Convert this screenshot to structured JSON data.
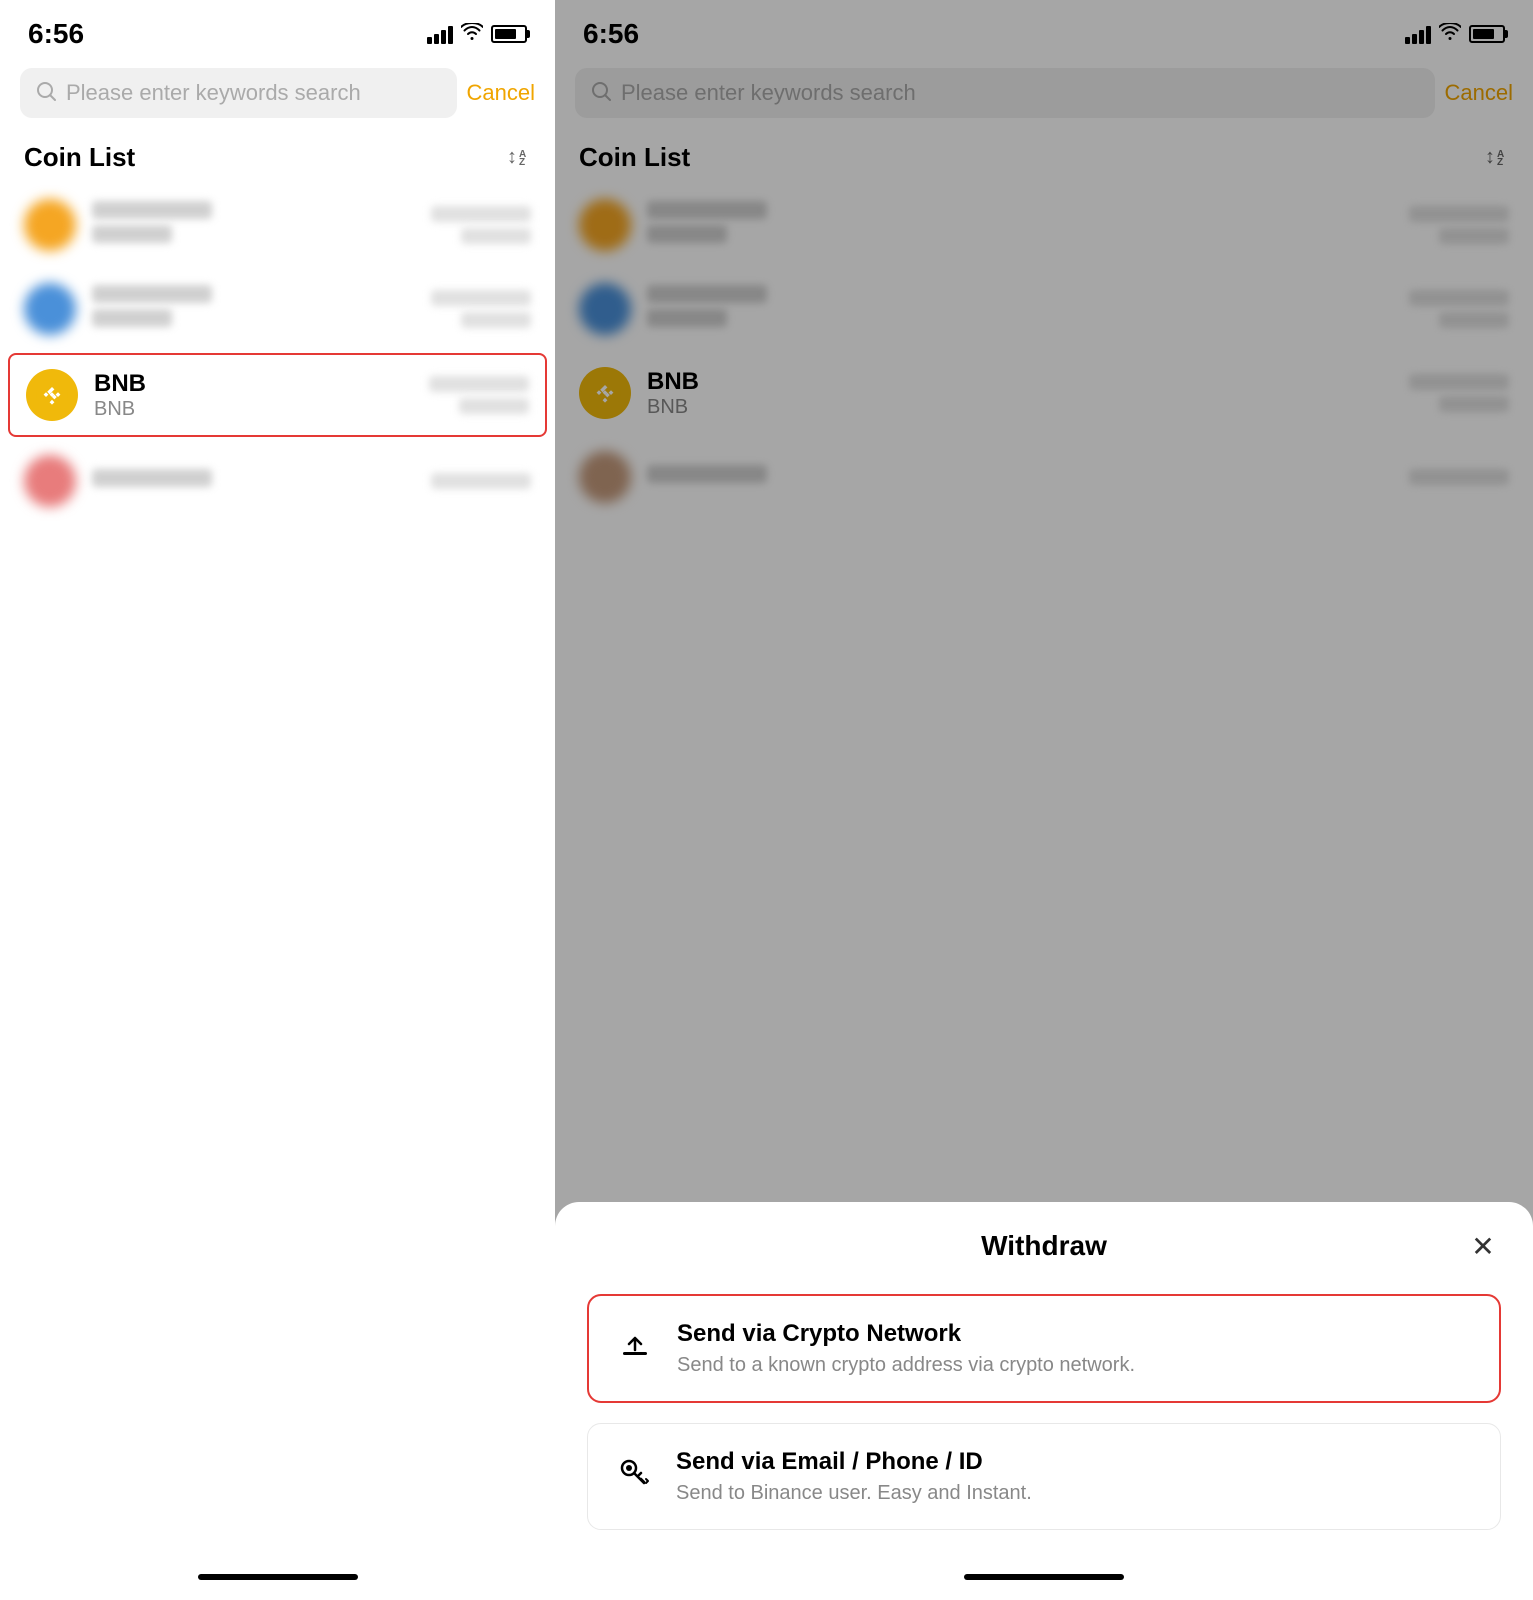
{
  "left_panel": {
    "status": {
      "time": "6:56"
    },
    "search": {
      "placeholder": "Please enter keywords search",
      "cancel_label": "Cancel"
    },
    "section": {
      "title": "Coin List"
    },
    "coins": [
      {
        "id": "coin-1",
        "name": "",
        "symbol": "",
        "icon_color": "orange",
        "highlighted": false,
        "blurred": true
      },
      {
        "id": "coin-2",
        "name": "",
        "symbol": "",
        "icon_color": "blue",
        "highlighted": false,
        "blurred": true
      },
      {
        "id": "bnb",
        "name": "BNB",
        "symbol": "BNB",
        "icon_color": "bnb",
        "highlighted": true,
        "blurred": false
      },
      {
        "id": "coin-4",
        "name": "",
        "symbol": "",
        "icon_color": "pink",
        "highlighted": false,
        "blurred": true
      }
    ]
  },
  "right_panel": {
    "status": {
      "time": "6:56"
    },
    "search": {
      "placeholder": "Please enter keywords search",
      "cancel_label": "Cancel"
    },
    "section": {
      "title": "Coin List"
    },
    "coins": [
      {
        "id": "coin-1",
        "name": "",
        "symbol": "",
        "icon_color": "orange",
        "blurred": true
      },
      {
        "id": "coin-2",
        "name": "",
        "symbol": "",
        "icon_color": "blue",
        "blurred": true
      },
      {
        "id": "bnb",
        "name": "BNB",
        "symbol": "BNB",
        "icon_color": "bnb",
        "blurred": false
      },
      {
        "id": "coin-4",
        "name": "",
        "symbol": "",
        "icon_color": "pink",
        "blurred": true
      }
    ],
    "withdraw_sheet": {
      "title": "Withdraw",
      "close_label": "×",
      "options": [
        {
          "id": "crypto-network",
          "title": "Send via Crypto Network",
          "description": "Send to a known crypto address via crypto network.",
          "icon": "upload",
          "highlighted": true
        },
        {
          "id": "email-phone",
          "title": "Send via Email / Phone / ID",
          "description": "Send to Binance user. Easy and Instant.",
          "icon": "key",
          "highlighted": false
        }
      ]
    }
  }
}
